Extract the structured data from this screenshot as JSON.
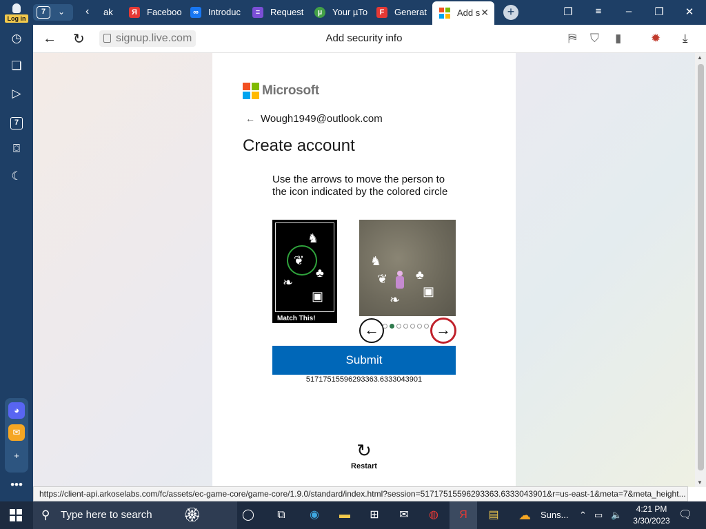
{
  "browser": {
    "login_label": "Log in",
    "tab_count": "7",
    "tabs": [
      {
        "label": "ak",
        "icon_color": "#1e3f66",
        "icon_text": ""
      },
      {
        "label": "Faceboo",
        "icon_color": "#e53935",
        "icon_text": "Я"
      },
      {
        "label": "Introduc",
        "icon_color": "#1877f2",
        "icon_text": "∞"
      },
      {
        "label": "Request",
        "icon_color": "#7b4fd6",
        "icon_text": "≡"
      },
      {
        "label": "Your µTo",
        "icon_color": "#43a047",
        "icon_text": "µ"
      },
      {
        "label": "Generat",
        "icon_color": "#e53935",
        "icon_text": "F"
      },
      {
        "label": "Add s",
        "icon_color": "#ffffff",
        "icon_text": ""
      }
    ],
    "url_domain": "signup.live.com",
    "page_title": "Add security info",
    "status_url": "https://client-api.arkoselabs.com/fc/assets/ec-game-core/game-core/1.9.0/standard/index.html?session=51717515596293363.6333043901&r=us-east-1&meta=7&meta_height..."
  },
  "page": {
    "brand": "Microsoft",
    "email": "Wough1949@outlook.com",
    "heading": "Create account",
    "instruction": "Use the arrows to move the person to the icon indicated by the colored circle",
    "match_label": "Match This!",
    "submit_label": "Submit",
    "session_id": "51717515596293363.6333043901",
    "restart_label": "Restart",
    "progress_dots_total": 8,
    "progress_dot_active": 2
  },
  "taskbar": {
    "search_placeholder": "Type here to search",
    "weather_label": "Suns...",
    "time": "4:21 PM",
    "date": "3/30/2023"
  },
  "colors": {
    "browser_chrome": "#1e3f66",
    "accent_blue": "#0067b8",
    "target_ring": "#2fa33c",
    "arrow_highlight": "#c0212b"
  }
}
